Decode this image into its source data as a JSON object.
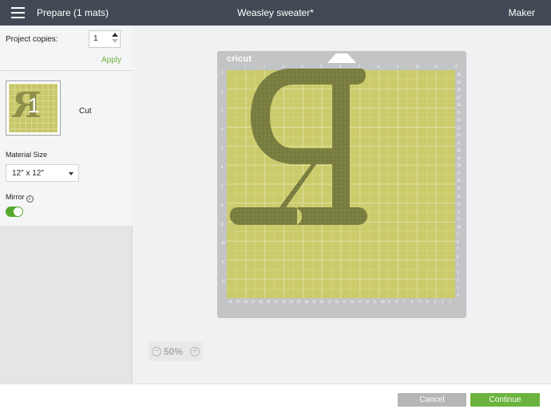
{
  "header": {
    "menu_icon": "hamburger-icon",
    "left_title": "Prepare (1 mats)",
    "project_title": "Weasley sweater*",
    "right_label": "Maker"
  },
  "sidebar": {
    "copies_label": "Project copies:",
    "copies_value": "1",
    "apply_label": "Apply",
    "mat_number": "1",
    "mat_letter": "R",
    "mat_action": "Cut",
    "material_size_label": "Material Size",
    "material_size_value": "12\" x 12\"",
    "mirror_label": "Mirror",
    "mirror_on": true
  },
  "mat": {
    "logo": "cricut",
    "letter": "R",
    "top_ruler": [
      "1",
      "2",
      "3",
      "4",
      "5",
      "6",
      "7",
      "8",
      "9",
      "10",
      "11",
      "12"
    ],
    "left_ruler": [
      "1",
      "2",
      "3",
      "4",
      "5",
      "6",
      "7",
      "8",
      "9",
      "10",
      "11",
      "12"
    ],
    "right_ruler": [
      "30",
      "29",
      "28",
      "27",
      "26",
      "25",
      "24",
      "23",
      "22",
      "21",
      "20",
      "19",
      "18",
      "17",
      "16",
      "15",
      "14",
      "13",
      "12",
      "11",
      "10",
      "9",
      "8",
      "7",
      "6",
      "5",
      "4",
      "3",
      "2",
      "1"
    ],
    "bottom_ruler": [
      "30",
      "29",
      "28",
      "27",
      "26",
      "25",
      "24",
      "23",
      "22",
      "21",
      "20",
      "19",
      "18",
      "17",
      "16",
      "15",
      "14",
      "13",
      "12",
      "11",
      "10",
      "9",
      "8",
      "7",
      "6",
      "5",
      "4",
      "3",
      "2",
      "1"
    ],
    "mat_color": "#cbcb6c",
    "design_color": "#7d8242"
  },
  "zoom": {
    "value": "50%",
    "minus": "−",
    "plus": "+"
  },
  "footer": {
    "cancel_label": "Cancel",
    "continue_label": "Continue"
  },
  "colors": {
    "header_bg": "#414a54",
    "accent_green": "#6cb33e"
  }
}
